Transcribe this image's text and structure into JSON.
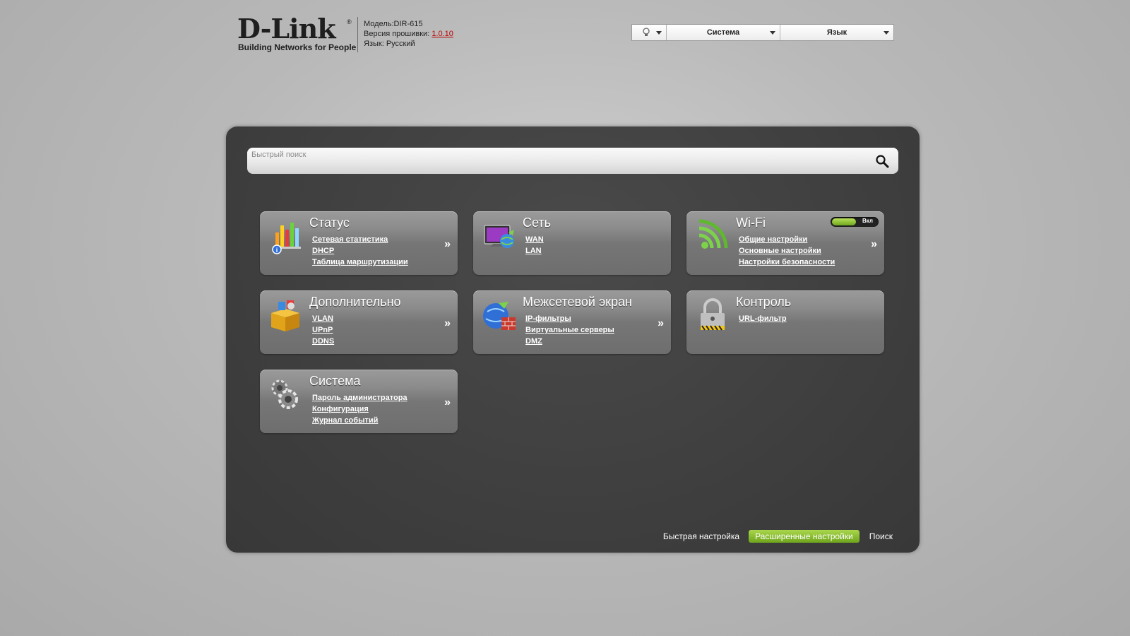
{
  "header": {
    "logo_text": "D-Link",
    "logo_reg": "®",
    "logo_tagline": "Building Networks for People",
    "model": "Модель:DIR-615",
    "firmware_label": "Версия прошивки: ",
    "firmware_value": "1.0.10",
    "language": "Язык: Русский"
  },
  "toolbar": {
    "system_label": "Система",
    "language_label": "Язык",
    "bulb_icon": "lightbulb-icon"
  },
  "search": {
    "placeholder": "Быстрый поиск",
    "icon": "magnifier-icon"
  },
  "tiles": {
    "status": {
      "title": "Статус",
      "links": [
        "Сетевая статистика",
        "DHCP",
        "Таблица маршрутизации"
      ],
      "more": "»",
      "icon": "chart-icon"
    },
    "network": {
      "title": "Сеть",
      "links": [
        "WAN",
        "LAN"
      ],
      "icon": "monitor-globe-icon"
    },
    "wifi": {
      "title": "Wi-Fi",
      "links": [
        "Общие настройки",
        "Основные настройки",
        "Настройки безопасности"
      ],
      "more": "»",
      "toggle_label": "Вкл",
      "toggle_on": true,
      "icon": "wifi-icon"
    },
    "advanced": {
      "title": "Дополнительно",
      "links": [
        "VLAN",
        "UPnP",
        "DDNS"
      ],
      "more": "»",
      "icon": "box-icon"
    },
    "firewall": {
      "title": "Межсетевой экран",
      "links": [
        "IP-фильтры",
        "Виртуальные серверы",
        "DMZ"
      ],
      "more": "»",
      "icon": "globe-firewall-icon"
    },
    "control": {
      "title": "Контроль",
      "links": [
        "URL-фильтр"
      ],
      "icon": "padlock-icon"
    },
    "system": {
      "title": "Система",
      "links": [
        "Пароль администратора",
        "Конфигурация",
        "Журнал событий"
      ],
      "more": "»",
      "icon": "gears-icon"
    }
  },
  "bottom": {
    "quick_setup": "Быстрая настройка",
    "advanced_settings": "Расширенные настройки",
    "search": "Поиск"
  },
  "colors": {
    "accent_green": "#7fb52a",
    "panel_bg": "#3f3f3f",
    "page_bg": "#bdbdbd"
  }
}
